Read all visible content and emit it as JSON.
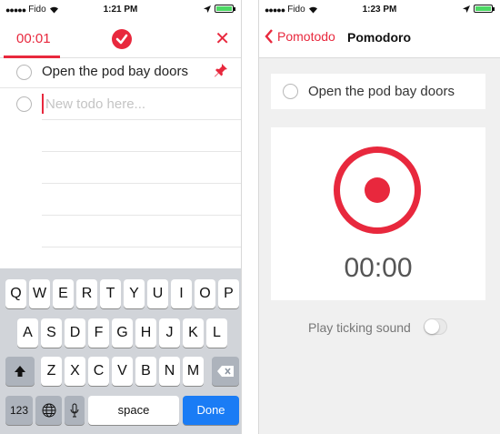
{
  "left_screen": {
    "status_bar": {
      "carrier": "Fido",
      "time": "1:21 PM"
    },
    "timer": "00:01",
    "todos": [
      {
        "text": "Open the pod bay doors",
        "pinned": true
      }
    ],
    "new_todo_placeholder": "New todo here...",
    "keyboard": {
      "row1": [
        "Q",
        "W",
        "E",
        "R",
        "T",
        "Y",
        "U",
        "I",
        "O",
        "P"
      ],
      "row2": [
        "A",
        "S",
        "D",
        "F",
        "G",
        "H",
        "J",
        "K",
        "L"
      ],
      "row3": [
        "Z",
        "X",
        "C",
        "V",
        "B",
        "N",
        "M"
      ],
      "numbers_label": "123",
      "space_label": "space",
      "done_label": "Done"
    }
  },
  "right_screen": {
    "status_bar": {
      "carrier": "Fido",
      "time": "1:23 PM"
    },
    "back_label": "Pomotodo",
    "title": "Pomodoro",
    "todo_text": "Open the pod bay doors",
    "timer": "00:00",
    "ticking_label": "Play ticking sound",
    "ticking_enabled": false
  },
  "colors": {
    "accent": "#e8283d",
    "done_key": "#1a7cf5"
  }
}
